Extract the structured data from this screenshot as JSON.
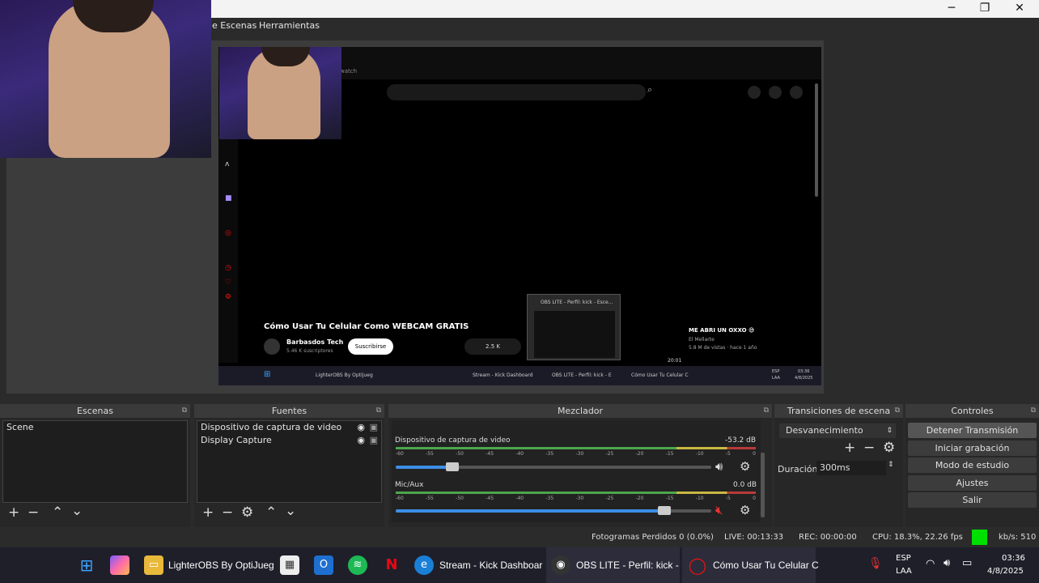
{
  "menu": {
    "scenes": "e Escenas",
    "tools": "Herramientas"
  },
  "preview_inner": {
    "video_title": "Cómo Usar Tu Celular Como WEBCAM GRATIS",
    "channel": "Barbasdos Tech",
    "subs": "5.46 K suscriptores",
    "subscribe": "Suscribirse",
    "likes": "2.5 K",
    "watch": "watch",
    "thumb_title": "OBS LITE - Perfil: kick - Esce...",
    "side_title": "ME ABRI UN OXXO 😅",
    "side_channel": "El Mellarte",
    "side_meta": "5.8 M de vistas · hace 1 año",
    "timestamp": "20:01",
    "taskbar": [
      "LighterOBS By OptiJueg",
      "Stream - Kick Dashboard",
      "OBS LITE - Perfil: kick - E",
      "Cómo Usar Tu Celular C"
    ],
    "lang": "ESP",
    "layout": "LAA",
    "time": "03:36",
    "date": "4/8/2025"
  },
  "docks": {
    "scenes": {
      "title": "Escenas",
      "items": [
        "Scene"
      ]
    },
    "sources": {
      "title": "Fuentes",
      "items": [
        "Dispositivo de captura de video",
        "Display Capture"
      ]
    },
    "mixer": {
      "title": "Mezclador",
      "channels": [
        {
          "name": "Dispositivo de captura de video",
          "db": "-53.2 dB",
          "level": 0.18
        },
        {
          "name": "Mic/Aux",
          "db": "0.0 dB",
          "level": 0.85,
          "muted": true
        }
      ],
      "ticks": [
        "-60",
        "-55",
        "-50",
        "-45",
        "-40",
        "-35",
        "-30",
        "-25",
        "-20",
        "-15",
        "-10",
        "-5",
        "0"
      ]
    },
    "transitions": {
      "title": "Transiciones de escena",
      "type": "Desvanecimiento",
      "duration_label": "Duración",
      "duration": "300ms"
    },
    "controls": {
      "title": "Controles",
      "buttons": [
        "Detener Transmisión",
        "Iniciar grabación",
        "Modo de estudio",
        "Ajustes",
        "Salir"
      ]
    }
  },
  "status": {
    "dropped": "Fotogramas Perdidos 0 (0.0%)",
    "live": "LIVE: 00:13:33",
    "rec": "REC: 00:00:00",
    "cpu": "CPU: 18.3%, 22.26 fps",
    "kbps": "kb/s: 510",
    "indicator_color": "#00e000"
  },
  "taskbar": {
    "apps": [
      "LighterOBS By OptiJueg",
      "Stream - Kick Dashboar",
      "OBS LITE - Perfil: kick - E",
      "Cómo Usar Tu Celular C"
    ],
    "lang": "ESP",
    "layout": "LAA",
    "time": "03:36",
    "date": "4/8/2025"
  }
}
